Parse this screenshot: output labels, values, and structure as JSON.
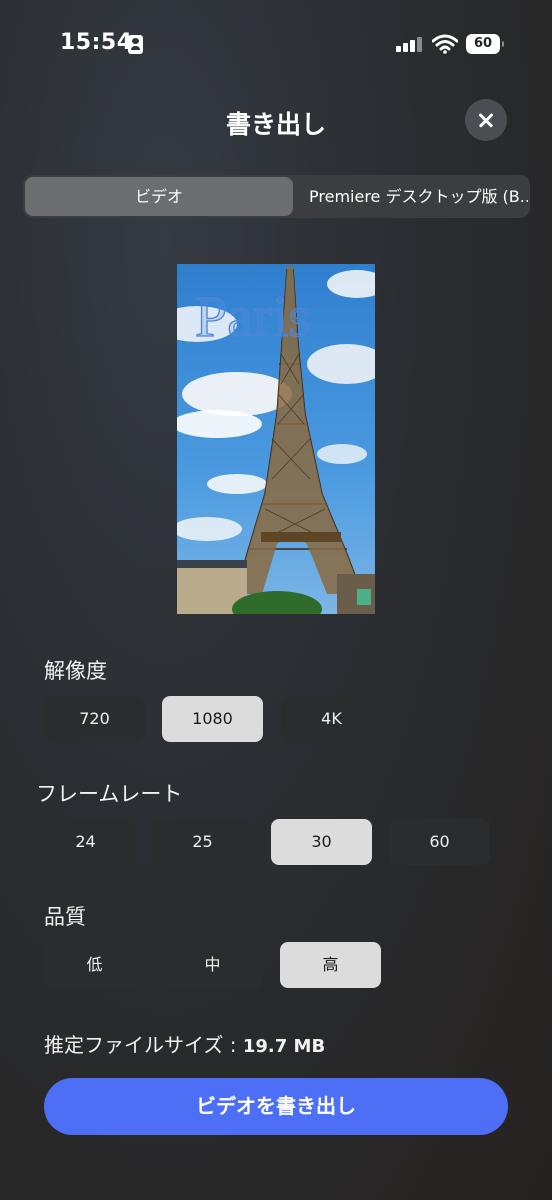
{
  "status_bar": {
    "time": "15:54",
    "battery": "60"
  },
  "header": {
    "title": "書き出し"
  },
  "tabs": [
    {
      "label": "ビデオ",
      "selected": true
    },
    {
      "label": "Premiere デスクトップ版 (B...",
      "selected": false
    }
  ],
  "preview": {
    "overlay_text": "Paris"
  },
  "resolution": {
    "label": "解像度",
    "options": [
      "720",
      "1080",
      "4K"
    ],
    "selected": "1080"
  },
  "framerate": {
    "label": "フレームレート",
    "options": [
      "24",
      "25",
      "30",
      "60"
    ],
    "selected": "30"
  },
  "quality": {
    "label": "品質",
    "options": [
      "低",
      "中",
      "高"
    ],
    "selected": "高"
  },
  "file_size": {
    "label": "推定ファイルサイズ :",
    "value": "19.7 MB"
  },
  "export_button": "ビデオを書き出し",
  "colors": {
    "accent": "#4c6ff6",
    "selected_option": "#dcdcdc",
    "option_bg": "#2b2c2e"
  }
}
